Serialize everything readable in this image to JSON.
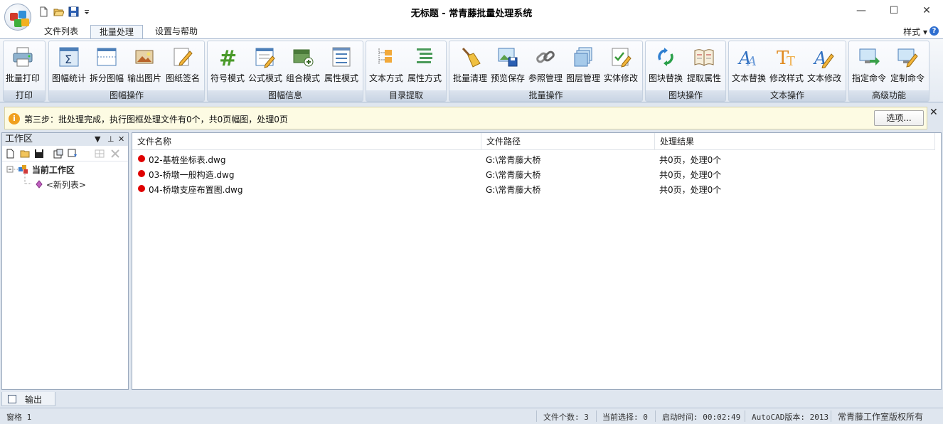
{
  "window": {
    "title": "无标题 - 常青藤批量处理系统",
    "controls": {
      "minimize": "—",
      "maximize": "☐",
      "close": "✕"
    }
  },
  "quick_access": [
    "new-icon",
    "open-icon",
    "save-icon",
    "customize-arrow-icon"
  ],
  "ribbon_tabs": [
    {
      "label": "文件列表",
      "active": false
    },
    {
      "label": "批量处理",
      "active": true
    },
    {
      "label": "设置与帮助",
      "active": false
    }
  ],
  "style_menu": "样式 ▾",
  "help": "?",
  "ribbon_groups": [
    {
      "label": "打印",
      "buttons": [
        {
          "label": "批量打印",
          "icon": "printer-icon"
        }
      ]
    },
    {
      "label": "图幅操作",
      "buttons": [
        {
          "label": "图幅统计",
          "icon": "sigma-icon"
        },
        {
          "label": "拆分图幅",
          "icon": "split-frame-icon"
        },
        {
          "label": "输出图片",
          "icon": "image-export-icon"
        },
        {
          "label": "图纸签名",
          "icon": "pencil-sign-icon"
        }
      ]
    },
    {
      "label": "图幅信息",
      "buttons": [
        {
          "label": "符号模式",
          "icon": "hash-icon"
        },
        {
          "label": "公式模式",
          "icon": "formula-icon"
        },
        {
          "label": "组合模式",
          "icon": "combine-icon"
        },
        {
          "label": "属性模式",
          "icon": "attribute-icon"
        }
      ]
    },
    {
      "label": "目录提取",
      "buttons": [
        {
          "label": "文本方式",
          "icon": "text-tree-icon"
        },
        {
          "label": "属性方式",
          "icon": "attr-tree-icon"
        }
      ]
    },
    {
      "label": "批量操作",
      "buttons": [
        {
          "label": "批量清理",
          "icon": "broom-icon"
        },
        {
          "label": "预览保存",
          "icon": "preview-save-icon"
        },
        {
          "label": "参照管理",
          "icon": "chain-link-icon"
        },
        {
          "label": "图层管理",
          "icon": "layers-icon"
        },
        {
          "label": "实体修改",
          "icon": "entity-edit-icon"
        }
      ]
    },
    {
      "label": "图块操作",
      "buttons": [
        {
          "label": "图块替换",
          "icon": "block-swap-icon"
        },
        {
          "label": "提取属性",
          "icon": "book-icon"
        }
      ]
    },
    {
      "label": "文本操作",
      "buttons": [
        {
          "label": "文本替换",
          "icon": "text-replace-icon"
        },
        {
          "label": "修改样式",
          "icon": "text-style-icon"
        },
        {
          "label": "文本修改",
          "icon": "text-edit-icon"
        }
      ]
    },
    {
      "label": "高级功能",
      "buttons": [
        {
          "label": "指定命令",
          "icon": "command-icon"
        },
        {
          "label": "定制命令",
          "icon": "custom-command-icon"
        }
      ]
    }
  ],
  "info_bar": {
    "message": "第三步：批处理完成，执行图框处理文件有0个，共0页幅图，处理0页",
    "options_button": "选项...",
    "close": "✕"
  },
  "workspace": {
    "title": "工作区",
    "header_controls": [
      "▼",
      "⊥",
      "✕"
    ],
    "tree": {
      "root": "当前工作区",
      "child": "<新列表>"
    }
  },
  "file_table": {
    "columns": [
      "文件名称",
      "文件路径",
      "处理结果"
    ],
    "rows": [
      {
        "name": "02-基桩坐标表.dwg",
        "path": "G:\\常青藤大桥",
        "result": "共0页，处理0个",
        "status_color": "#e00000"
      },
      {
        "name": "03-桥墩一般构造.dwg",
        "path": "G:\\常青藤大桥",
        "result": "共0页，处理0个",
        "status_color": "#e00000"
      },
      {
        "name": "04-桥墩支座布置图.dwg",
        "path": "G:\\常青藤大桥",
        "result": "共0页，处理0个",
        "status_color": "#e00000"
      }
    ]
  },
  "output_tab": "输出",
  "status_bar": {
    "pane": "窗格 1",
    "file_count": "文件个数: 3",
    "current_selection": "当前选择: 0",
    "start_time": "启动时间: 00:02:49",
    "autocad_version": "AutoCAD版本: 2013",
    "copyright": "常青藤工作室版权所有"
  }
}
